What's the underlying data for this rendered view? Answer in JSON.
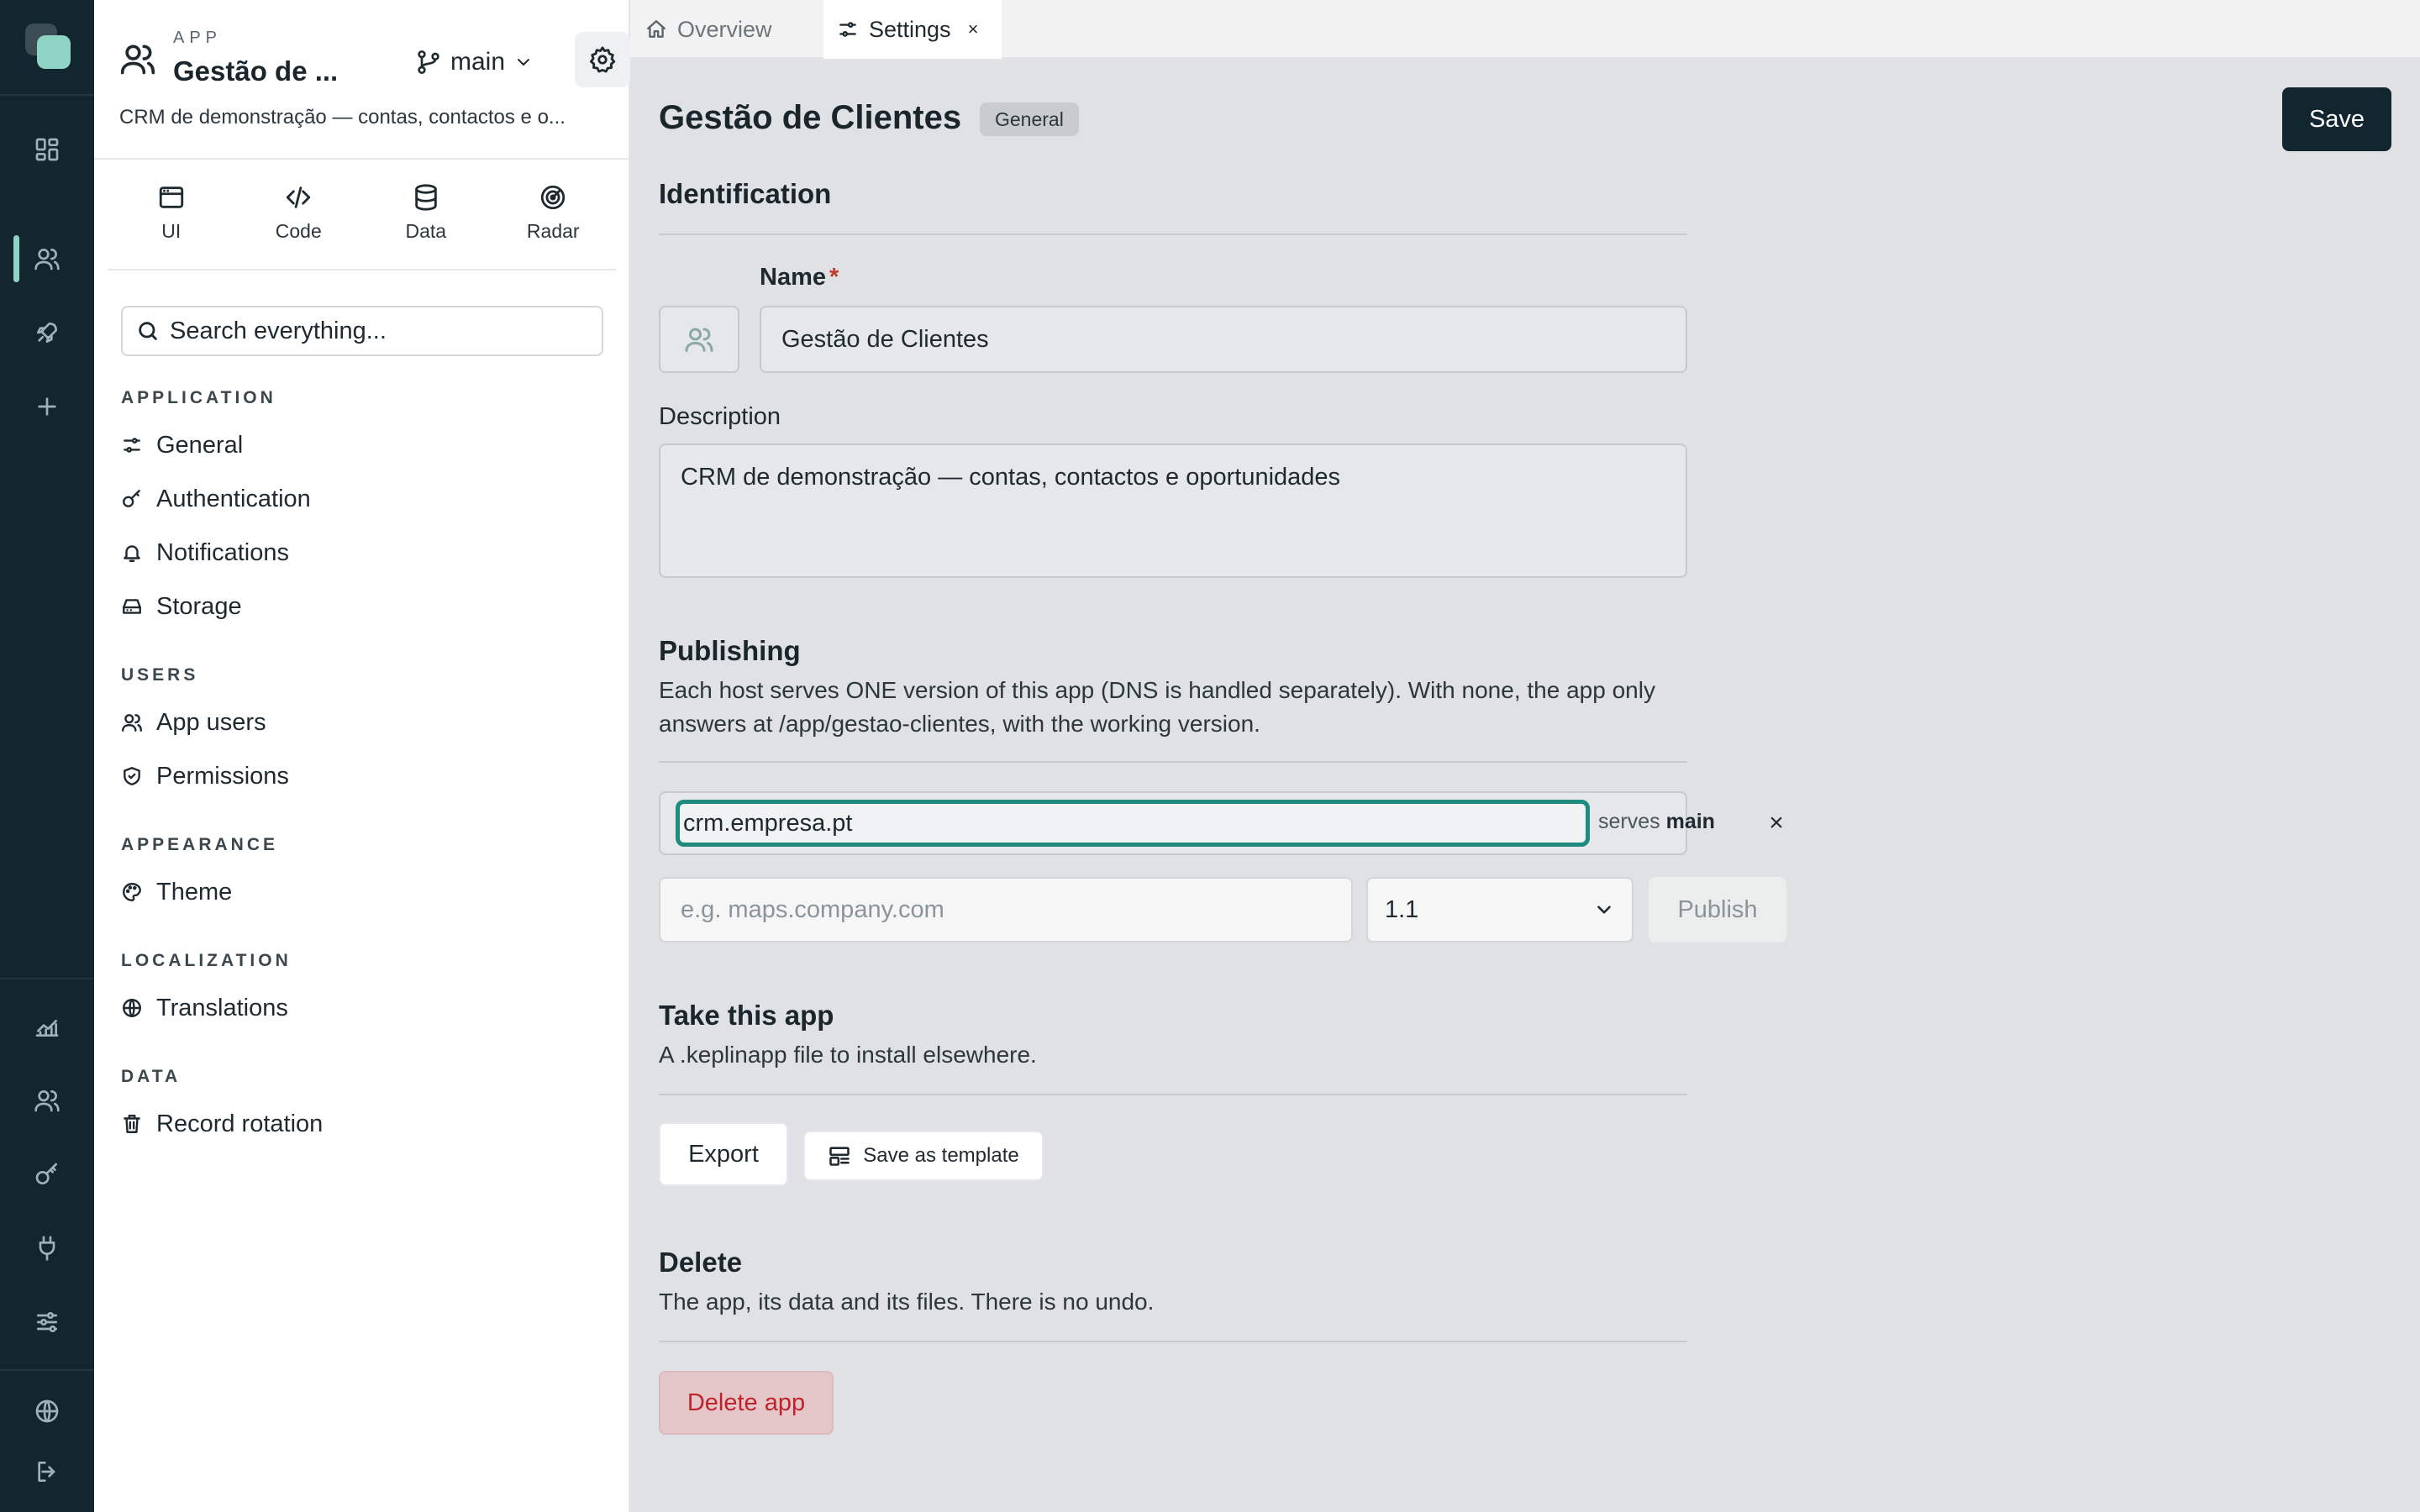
{
  "rail": {
    "icons": [
      "logo",
      "grid-icon",
      "users-icon",
      "rocket-icon",
      "plus-icon",
      "chart-icon",
      "users-icon",
      "key-icon",
      "plug-icon",
      "sliders-icon",
      "globe-icon",
      "logout-icon"
    ],
    "active": "users-icon",
    "accent": "#8fd3c5"
  },
  "app": {
    "kicker": "APP",
    "name": "Gestão de ...",
    "branch": "main",
    "description": "CRM de demonstração — contas, contactos e o..."
  },
  "tools": [
    {
      "label": "UI",
      "icon": "window-icon"
    },
    {
      "label": "Code",
      "icon": "code-icon"
    },
    {
      "label": "Data",
      "icon": "database-icon"
    },
    {
      "label": "Radar",
      "icon": "radar-icon"
    }
  ],
  "search": {
    "placeholder": "Search everything..."
  },
  "nav": {
    "groups": [
      {
        "title": "APPLICATION",
        "items": [
          {
            "label": "General",
            "icon": "sliders-icon"
          },
          {
            "label": "Authentication",
            "icon": "key-icon"
          },
          {
            "label": "Notifications",
            "icon": "bell-icon"
          },
          {
            "label": "Storage",
            "icon": "storage-icon"
          }
        ]
      },
      {
        "title": "USERS",
        "items": [
          {
            "label": "App users",
            "icon": "users-icon"
          },
          {
            "label": "Permissions",
            "icon": "shield-icon"
          }
        ]
      },
      {
        "title": "APPEARANCE",
        "items": [
          {
            "label": "Theme",
            "icon": "palette-icon"
          }
        ]
      },
      {
        "title": "LOCALIZATION",
        "items": [
          {
            "label": "Translations",
            "icon": "globe-icon"
          }
        ]
      },
      {
        "title": "DATA",
        "items": [
          {
            "label": "Record rotation",
            "icon": "trash-icon"
          }
        ]
      }
    ]
  },
  "tabs": [
    {
      "label": "Overview",
      "icon": "home-icon"
    },
    {
      "label": "Settings",
      "icon": "sliders-icon",
      "close": "×"
    }
  ],
  "main": {
    "title": "Gestão de Clientes",
    "badge": "General",
    "save_label": "Save",
    "identification": {
      "heading": "Identification",
      "name_label": "Name",
      "required_mark": "*",
      "name_value": "Gestão de Clientes",
      "description_label": "Description",
      "description_value": "CRM de demonstração — contas, contactos e oportunidades"
    },
    "publishing": {
      "heading": "Publishing",
      "text": "Each host serves ONE version of this app (DNS is handled separately). With none, the app only answers at /app/gestao-clientes, with the working version.",
      "host_value": "crm.empresa.pt",
      "serves_prefix": "serves",
      "serves_branch": "main",
      "remove": "×",
      "new_host_placeholder": "e.g. maps.company.com",
      "version": "1.1",
      "publish_label": "Publish"
    },
    "take": {
      "heading": "Take this app",
      "text": "A .keplinapp file to install elsewhere.",
      "export_label": "Export",
      "template_label": "Save as template"
    },
    "delete": {
      "heading": "Delete",
      "text": "The app, its data and its files. There is no undo.",
      "button_label": "Delete app"
    }
  }
}
